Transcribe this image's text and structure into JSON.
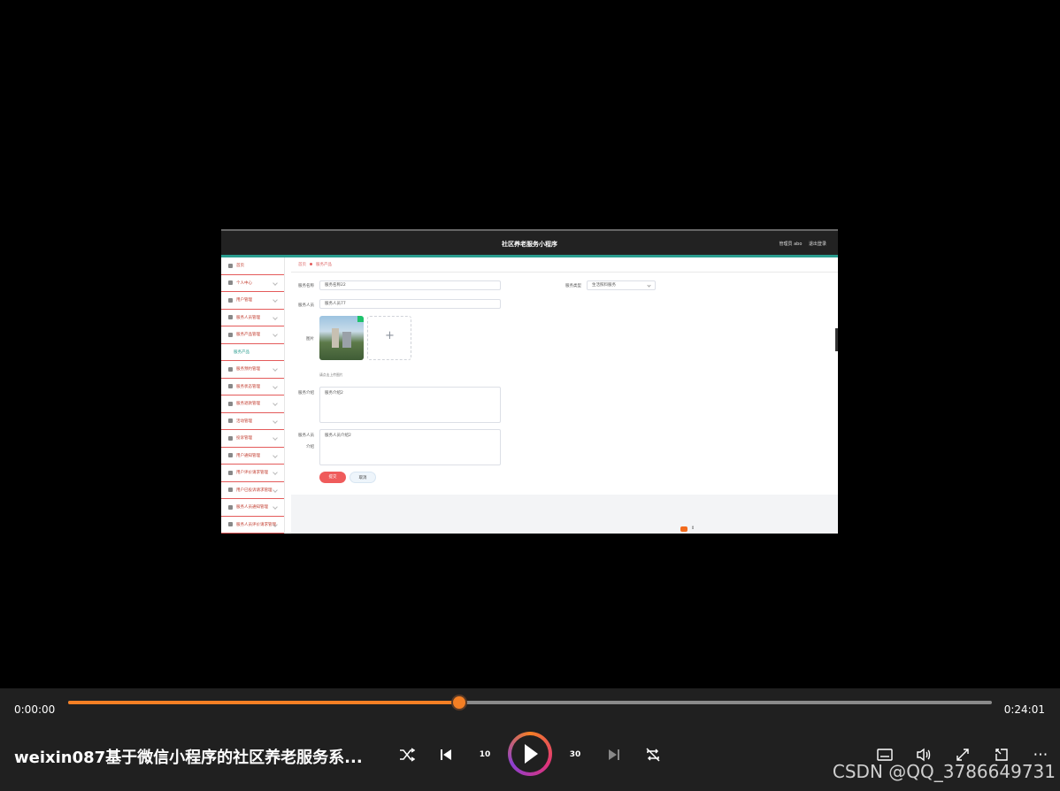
{
  "page": {
    "title": "社区养老服务小程序",
    "user_label": "管理员 abo",
    "logout": "退出登录"
  },
  "sidebar": {
    "items": [
      {
        "label": "首页",
        "icon": "home-icon"
      },
      {
        "label": "个人中心",
        "icon": "user-icon"
      },
      {
        "label": "用户管理",
        "icon": "users-icon"
      },
      {
        "label": "服务人员管理",
        "icon": "staff-icon"
      },
      {
        "label": "服务产品管理",
        "icon": "product-icon",
        "expanded": true
      },
      {
        "label": "服务预约管理",
        "icon": "calendar-icon"
      },
      {
        "label": "服务状态管理",
        "icon": "status-icon"
      },
      {
        "label": "服务退款管理",
        "icon": "refund-icon"
      },
      {
        "label": "活动管理",
        "icon": "activity-icon"
      },
      {
        "label": "投诉管理",
        "icon": "complaint-icon"
      },
      {
        "label": "用户通知管理",
        "icon": "notice-icon"
      },
      {
        "label": "用户评价请求管理",
        "icon": "review-icon"
      },
      {
        "label": "用户已投诉请求管理",
        "icon": "clock-icon"
      },
      {
        "label": "服务人员通知管理",
        "icon": "notice-icon"
      },
      {
        "label": "服务人员评价请求管理",
        "icon": "review-icon"
      }
    ],
    "sub_item": "服务产品"
  },
  "breadcrumb": {
    "home": "首页",
    "current": "服务产品"
  },
  "form": {
    "service_name_label": "服务名称",
    "service_name_value": "服务名称22",
    "service_type_label": "服务类型",
    "service_type_value": "生活照料服务",
    "staff_label": "服务人员",
    "staff_value": "服务人员77",
    "image_label": "图片",
    "image_hint": "请点击上传图片",
    "intro_label": "服务介绍",
    "intro_value": "服务介绍2",
    "staff_intro_label_1": "服务人员",
    "staff_intro_label_2": "介绍",
    "staff_intro_value": "服务人员介绍2",
    "submit": "提交",
    "cancel": "取消"
  },
  "player": {
    "time_current": "0:00:00",
    "time_total": "0:24:01",
    "progress": 0.423,
    "video_title": "weixin087基于微信小程序的社区养老服务系...",
    "skip_back": "10",
    "skip_forward": "30",
    "accent_color": "#f47f24"
  },
  "watermark": "CSDN @QQ_3786649731"
}
